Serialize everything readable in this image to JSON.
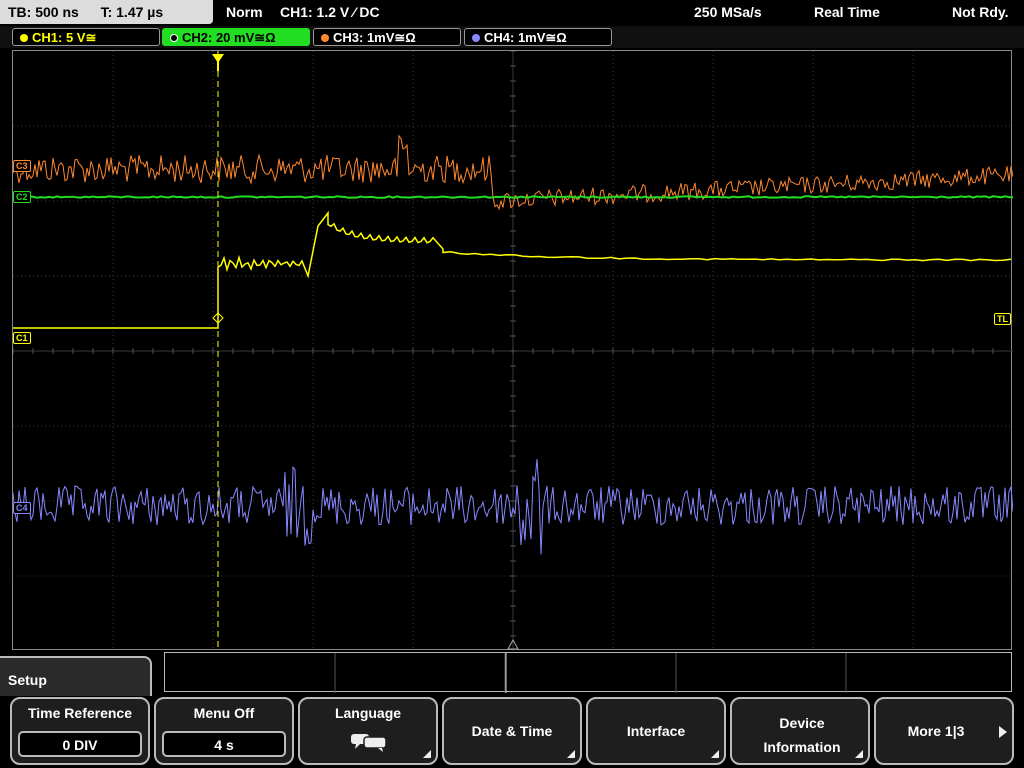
{
  "status_bar": {
    "timebase": "TB: 500 ns",
    "trigger_time": "T: 1.47 µs",
    "trigger_mode": "Norm",
    "trigger_setting": "CH1: 1.2 V ⁄ DC",
    "sample_rate": "250 MSa/s",
    "acq_mode": "Real Time",
    "status": "Not Rdy."
  },
  "channels": [
    {
      "label": "CH1: 5 V≅",
      "color": "#ffff00"
    },
    {
      "label": "CH2: 20 mV≅Ω",
      "color": "#22dd22"
    },
    {
      "label": "CH3: 1mV≅Ω",
      "color": "#ff8830"
    },
    {
      "label": "CH4: 1mV≅Ω",
      "color": "#8888ff"
    }
  ],
  "markers": {
    "c1": "C1",
    "c2": "C2",
    "c3": "C3",
    "c4": "C4",
    "trigger_level": "TL"
  },
  "menu": {
    "title": "Setup",
    "softkeys": [
      {
        "label": "Time Reference",
        "value": "0 DIV"
      },
      {
        "label": "Menu Off",
        "value": "4 s"
      },
      {
        "label": "Language",
        "icon": "speech-bubbles-icon"
      },
      {
        "label": "Date & Time"
      },
      {
        "label": "Interface"
      },
      {
        "label": "Device Information"
      },
      {
        "label": "More 1|3"
      }
    ]
  }
}
